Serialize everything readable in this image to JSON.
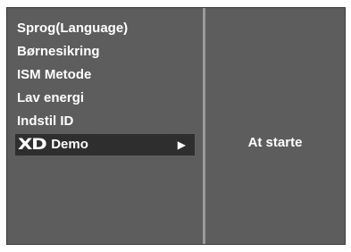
{
  "menu": {
    "items": [
      {
        "label": "Sprog(Language)"
      },
      {
        "label": "Børnesikring"
      },
      {
        "label": "ISM Metode"
      },
      {
        "label": "Lav energi"
      },
      {
        "label": "Indstil ID"
      }
    ],
    "selected": {
      "logo_text": "XD",
      "label": "Demo",
      "arrow": "▶"
    }
  },
  "submenu": {
    "label": "At starte"
  },
  "colors": {
    "panel": "#5d5d5d",
    "divider": "#9a9a9a",
    "selected_bg": "#2e2e2e",
    "text": "#ffffff"
  }
}
